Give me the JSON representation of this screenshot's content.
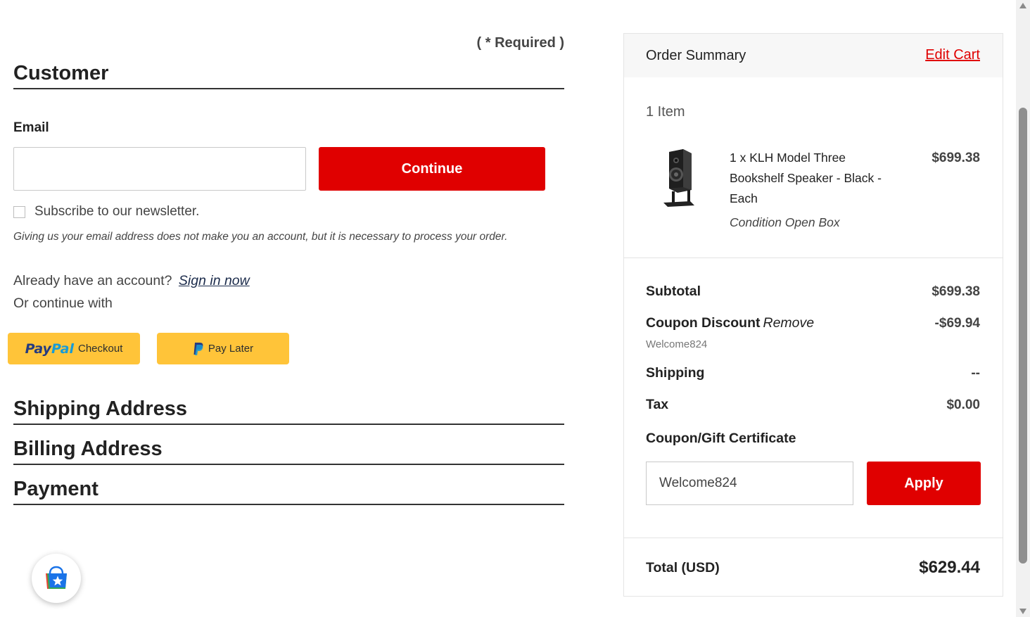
{
  "checkout": {
    "required_note": "( * Required )",
    "customer": {
      "heading": "Customer",
      "email_label": "Email",
      "email_value": "",
      "continue_label": "Continue",
      "subscribe_label": "Subscribe to our newsletter.",
      "email_note": "Giving us your email address does not make you an account, but it is necessary to process your order.",
      "account_prompt": "Already have an account?",
      "sign_in_label": "Sign in now",
      "or_continue": "Or continue with",
      "paypal_brand_pay": "Pay",
      "paypal_brand_pal": "Pal",
      "paypal_checkout_label": "Checkout",
      "paylater_label": "Pay Later"
    },
    "sections": {
      "shipping": "Shipping Address",
      "billing": "Billing Address",
      "payment": "Payment"
    }
  },
  "summary": {
    "title": "Order Summary",
    "edit_cart": "Edit Cart",
    "item_count": "1 Item",
    "item": {
      "name": "1 x KLH Model Three Bookshelf Speaker - Black - Each",
      "price": "$699.38",
      "condition": "Condition Open Box",
      "icon": "speaker-icon"
    },
    "subtotal_label": "Subtotal",
    "subtotal_value": "$699.38",
    "coupon_label": "Coupon Discount",
    "coupon_remove": "Remove",
    "coupon_value": "-$69.94",
    "coupon_code": "Welcome824",
    "shipping_label": "Shipping",
    "shipping_value": "--",
    "tax_label": "Tax",
    "tax_value": "$0.00",
    "gift_label": "Coupon/Gift Certificate",
    "gift_input_value": "Welcome824",
    "apply_label": "Apply",
    "total_label": "Total (USD)",
    "total_value": "$629.44"
  },
  "colors": {
    "accent": "#e00000",
    "paypal_yellow": "#ffc439",
    "paypal_dark_blue": "#253b80",
    "paypal_light_blue": "#179bd7"
  }
}
